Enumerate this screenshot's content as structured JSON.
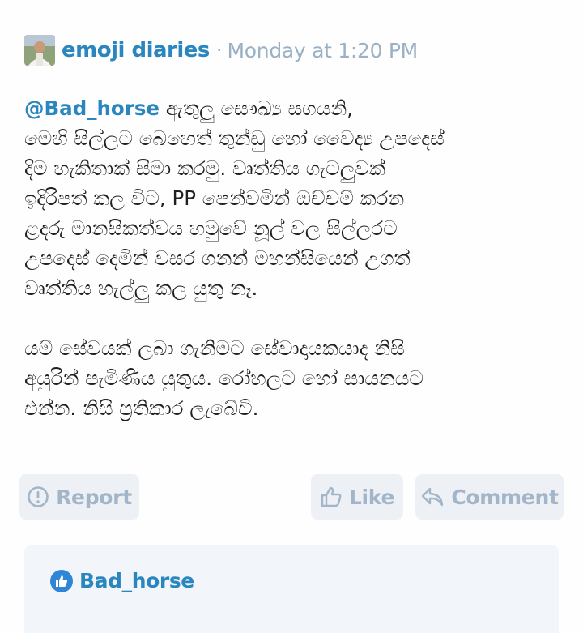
{
  "post": {
    "author": "emoji diaries",
    "separator": "·",
    "timestamp": "Monday at 1:20 PM",
    "mention": "@Bad_horse",
    "paragraph1_rest": " ඇතුලු සෞඛ්‍ය සගයනි,\nමෙහි සිල්ලට බෙහෙත් තුන්ඩු හෝ වෛද්‍ය උපදෙස්\nදිම හැකිතාක් සිමා කරමු. වෘත්තිය ගැටලුවක්\nඉදිරිපත් කල විට, PP පෙන්වමින් ඔච්චම් කරන\nළදරු මානසිකත්වය හමුවේ නූල් වල සිල්ලරට\nඋපදෙස් දෙමින් වසර ගනන් මහන්සියෙන් උගත්\nවෘත්තිය හැල්ලු කල යුතු නෑ.",
    "paragraph2": "යම් සේවයක් ලබා ගැනිමට සේවාදායකයාද නිසි\nඅයුරින් පැමිණිය යුතුය. රෝහලට හෝ සායනයට\nඑන්න. නිසි ප්‍රතිකාර ලැබේවි."
  },
  "actions": {
    "report_label": "Report",
    "like_label": "Like",
    "comment_label": "Comment"
  },
  "likes": {
    "liker": "Bad_horse"
  },
  "colors": {
    "link": "#2a86be",
    "muted": "#9ab0c4",
    "button_bg": "#edf1f6",
    "button_text": "#a3b5c8",
    "like_badge": "#2f86d6"
  },
  "icons": {
    "report": "exclamation-circle-icon",
    "like": "thumbs-up-icon",
    "comment": "reply-arrow-icon",
    "like_badge": "thumbs-up-badge-icon"
  }
}
